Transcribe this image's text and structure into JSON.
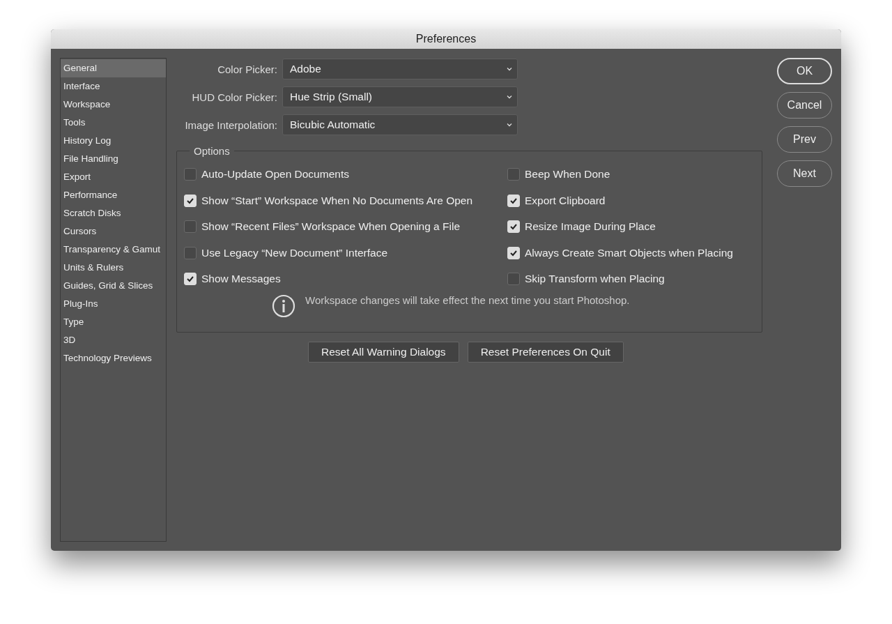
{
  "window": {
    "title": "Preferences"
  },
  "sidebar": {
    "items": [
      {
        "label": "General",
        "selected": true
      },
      {
        "label": "Interface",
        "selected": false
      },
      {
        "label": "Workspace",
        "selected": false
      },
      {
        "label": "Tools",
        "selected": false
      },
      {
        "label": "History Log",
        "selected": false
      },
      {
        "label": "File Handling",
        "selected": false
      },
      {
        "label": "Export",
        "selected": false
      },
      {
        "label": "Performance",
        "selected": false
      },
      {
        "label": "Scratch Disks",
        "selected": false
      },
      {
        "label": "Cursors",
        "selected": false
      },
      {
        "label": "Transparency & Gamut",
        "selected": false
      },
      {
        "label": "Units & Rulers",
        "selected": false
      },
      {
        "label": "Guides, Grid & Slices",
        "selected": false
      },
      {
        "label": "Plug-Ins",
        "selected": false
      },
      {
        "label": "Type",
        "selected": false
      },
      {
        "label": "3D",
        "selected": false
      },
      {
        "label": "Technology Previews",
        "selected": false
      }
    ]
  },
  "fields": [
    {
      "label": "Color Picker:",
      "value": "Adobe"
    },
    {
      "label": "HUD Color Picker:",
      "value": "Hue Strip (Small)"
    },
    {
      "label": "Image Interpolation:",
      "value": "Bicubic Automatic"
    }
  ],
  "options": {
    "title": "Options",
    "columns": [
      {
        "items": [
          {
            "label": "Auto-Update Open Documents",
            "checked": false
          },
          {
            "label": "Show “Start” Workspace When No Documents Are Open",
            "checked": true
          },
          {
            "label": "Show “Recent Files” Workspace When Opening a File",
            "checked": false
          },
          {
            "label": "Use Legacy “New Document” Interface",
            "checked": false
          },
          {
            "label": "Show Messages",
            "checked": true
          }
        ]
      },
      {
        "items": [
          {
            "label": "Beep When Done",
            "checked": false
          },
          {
            "label": "Export Clipboard",
            "checked": true
          },
          {
            "label": "Resize Image During Place",
            "checked": true
          },
          {
            "label": "Always Create Smart Objects when Placing",
            "checked": true
          },
          {
            "label": "Skip Transform when Placing",
            "checked": false
          }
        ]
      }
    ],
    "note": "Workspace changes will take effect the next time you start Photoshop."
  },
  "reset_buttons": [
    "Reset All Warning Dialogs",
    "Reset Preferences On Quit"
  ],
  "dialog_buttons": [
    "OK",
    "Cancel",
    "Prev",
    "Next"
  ]
}
